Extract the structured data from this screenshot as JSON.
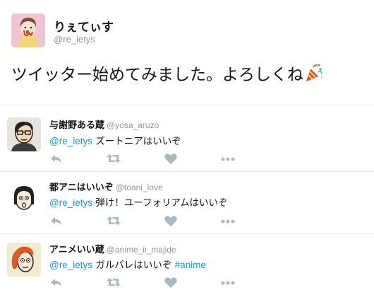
{
  "main_tweet": {
    "display_name": "りぇてぃす",
    "handle": "@re_ietys",
    "text": "ツイッター始めてみました。よろしくね",
    "emoji": "party-popper-icon"
  },
  "replies": [
    {
      "display_name": "与謝野ある蔵",
      "handle": "@yosa_aruzo",
      "mention": "@re_ietys",
      "text": " ズートニアはいいぞ",
      "hashtag": ""
    },
    {
      "display_name": "都アニはいいぞ",
      "handle": "@toani_love",
      "mention": "@re_ietys",
      "text": " 弾け！ユーフォリアムはいいぞ",
      "hashtag": ""
    },
    {
      "display_name": "アニメいい蔵",
      "handle": "@anime_ii_majide",
      "mention": "@re_ietys",
      "text": " ガルパレはいいぞ ",
      "hashtag": "#anime"
    }
  ],
  "actions": [
    "reply-icon",
    "retweet-icon",
    "like-icon",
    "more-icon"
  ],
  "colors": {
    "link": "#1b95e0",
    "muted": "#8899a6",
    "icon": "#aab8c2",
    "divider": "#e6ecf0",
    "avatar_main_bg": "#f1c4d3"
  }
}
